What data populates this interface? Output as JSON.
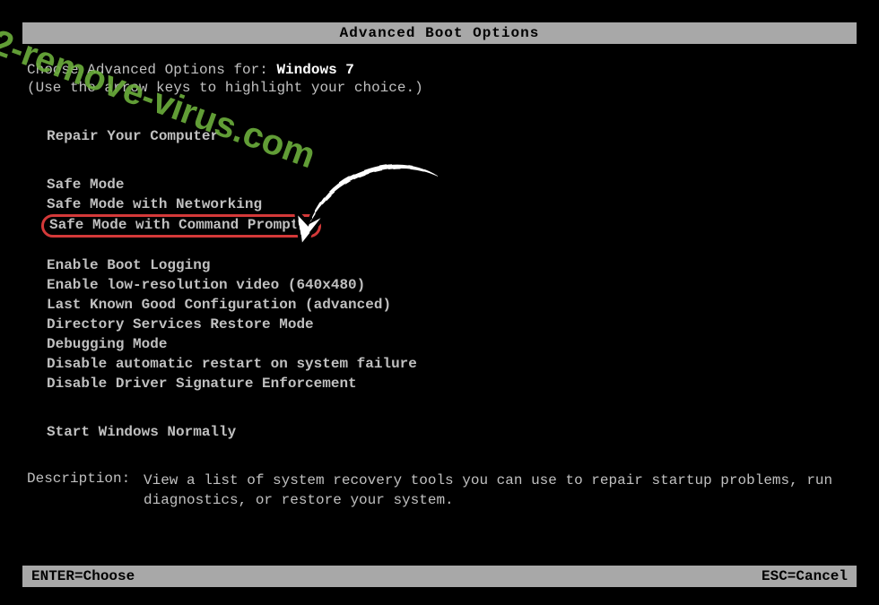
{
  "title": "Advanced Boot Options",
  "prompt": {
    "label": "Choose Advanced Options for: ",
    "os": "Windows 7",
    "hint": "(Use the arrow keys to highlight your choice.)"
  },
  "menu": {
    "group1": [
      "Repair Your Computer"
    ],
    "group2": [
      "Safe Mode",
      "Safe Mode with Networking",
      "Safe Mode with Command Prompt"
    ],
    "group3": [
      "Enable Boot Logging",
      "Enable low-resolution video (640x480)",
      "Last Known Good Configuration (advanced)",
      "Directory Services Restore Mode",
      "Debugging Mode",
      "Disable automatic restart on system failure",
      "Disable Driver Signature Enforcement"
    ],
    "group4": [
      "Start Windows Normally"
    ],
    "highlighted_index": 2
  },
  "description": {
    "label": "Description:",
    "text": "View a list of system recovery tools you can use to repair startup problems, run diagnostics, or restore your system."
  },
  "footer": {
    "left": "ENTER=Choose",
    "right": "ESC=Cancel"
  },
  "watermark": "2-remove-virus.com"
}
